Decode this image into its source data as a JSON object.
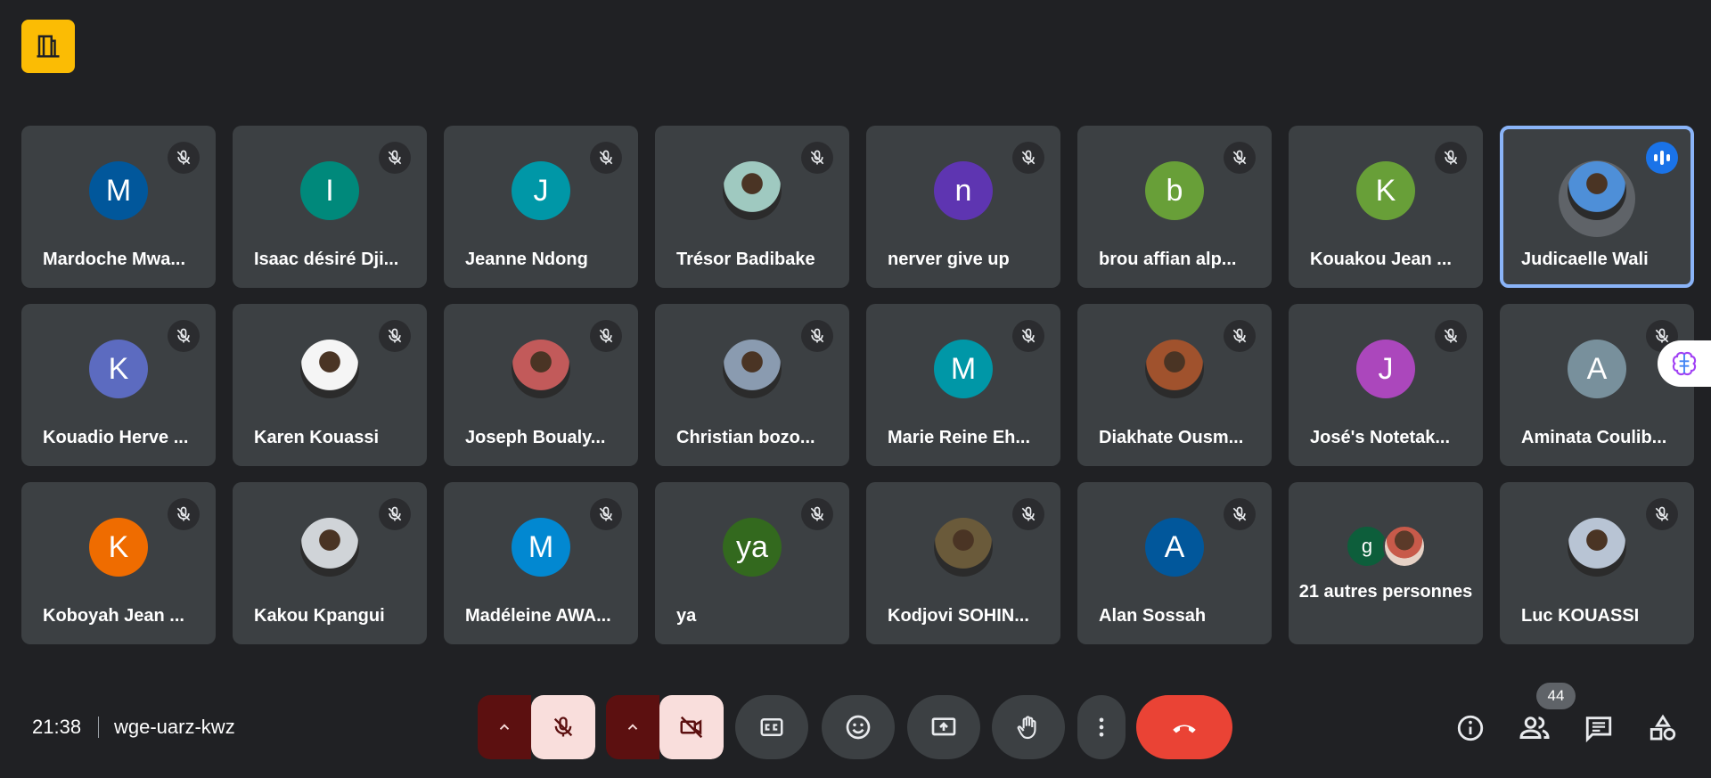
{
  "app": {
    "logo_icon": "door-exit-icon",
    "accent": "#fbbc04"
  },
  "participants": [
    {
      "name": "Mardoche Mwa...",
      "initial": "M",
      "color": "#01579b",
      "type": "initial"
    },
    {
      "name": "Isaac désiré Dji...",
      "initial": "I",
      "color": "#00897b",
      "type": "initial"
    },
    {
      "name": "Jeanne Ndong",
      "initial": "J",
      "color": "#0097a7",
      "type": "initial"
    },
    {
      "name": "Trésor Badibake",
      "initial": "",
      "color": "#9fc9c0",
      "type": "photo"
    },
    {
      "name": "nerver give up",
      "initial": "n",
      "color": "#5e35b1",
      "type": "initial"
    },
    {
      "name": "brou affian alp...",
      "initial": "b",
      "color": "#689f38",
      "type": "initial"
    },
    {
      "name": "Kouakou Jean ...",
      "initial": "K",
      "color": "#689f38",
      "type": "initial"
    },
    {
      "name": "Judicaelle Wali",
      "initial": "",
      "color": "#4e8fd8",
      "type": "photo",
      "active": true
    },
    {
      "name": "Kouadio Herve ...",
      "initial": "K",
      "color": "#5c6bc0",
      "type": "initial"
    },
    {
      "name": "Karen Kouassi",
      "initial": "",
      "color": "#f5f5f5",
      "type": "photo"
    },
    {
      "name": "Joseph Boualy...",
      "initial": "",
      "color": "#c25a5a",
      "type": "photo"
    },
    {
      "name": "Christian bozo...",
      "initial": "",
      "color": "#8a9bb0",
      "type": "photo"
    },
    {
      "name": "Marie Reine Eh...",
      "initial": "M",
      "color": "#0097a7",
      "type": "initial"
    },
    {
      "name": "Diakhate Ousm...",
      "initial": "",
      "color": "#a0522d",
      "type": "photo"
    },
    {
      "name": "José's Notetak...",
      "initial": "J",
      "color": "#ab47bc",
      "type": "initial"
    },
    {
      "name": "Aminata Coulib...",
      "initial": "A",
      "color": "#78909c",
      "type": "initial"
    },
    {
      "name": "Koboyah Jean ...",
      "initial": "K",
      "color": "#ef6c00",
      "type": "initial"
    },
    {
      "name": "Kakou Kpangui",
      "initial": "",
      "color": "#d0d4d8",
      "type": "photo"
    },
    {
      "name": "Madéleine AWA...",
      "initial": "M",
      "color": "#0288d1",
      "type": "initial"
    },
    {
      "name": "ya",
      "initial": "ya",
      "color": "#33691e",
      "type": "initial"
    },
    {
      "name": "Kodjovi SOHIN...",
      "initial": "",
      "color": "#6a5a3a",
      "type": "photo"
    },
    {
      "name": "Alan Sossah",
      "initial": "A",
      "color": "#01579b",
      "type": "initial"
    },
    {
      "name": "21 autres personnes",
      "initial": "g",
      "color": "#0d5e3b",
      "type": "others"
    },
    {
      "name": "Luc KOUASSI",
      "initial": "",
      "color": "#b8c4d4",
      "type": "photo"
    }
  ],
  "meeting": {
    "time": "21:38",
    "code": "wge-uarz-kwz",
    "participant_count": "44"
  },
  "controls": {
    "mic_icon": "mic-off-icon",
    "camera_icon": "camera-off-icon",
    "captions_icon": "closed-captions-icon",
    "emoji_icon": "emoji-icon",
    "present_icon": "present-screen-icon",
    "hand_icon": "raise-hand-icon",
    "more_icon": "more-vert-icon",
    "end_icon": "end-call-icon",
    "end_color": "#ea4335"
  },
  "right_controls": [
    "info-icon",
    "people-icon",
    "chat-icon",
    "activities-icon"
  ]
}
